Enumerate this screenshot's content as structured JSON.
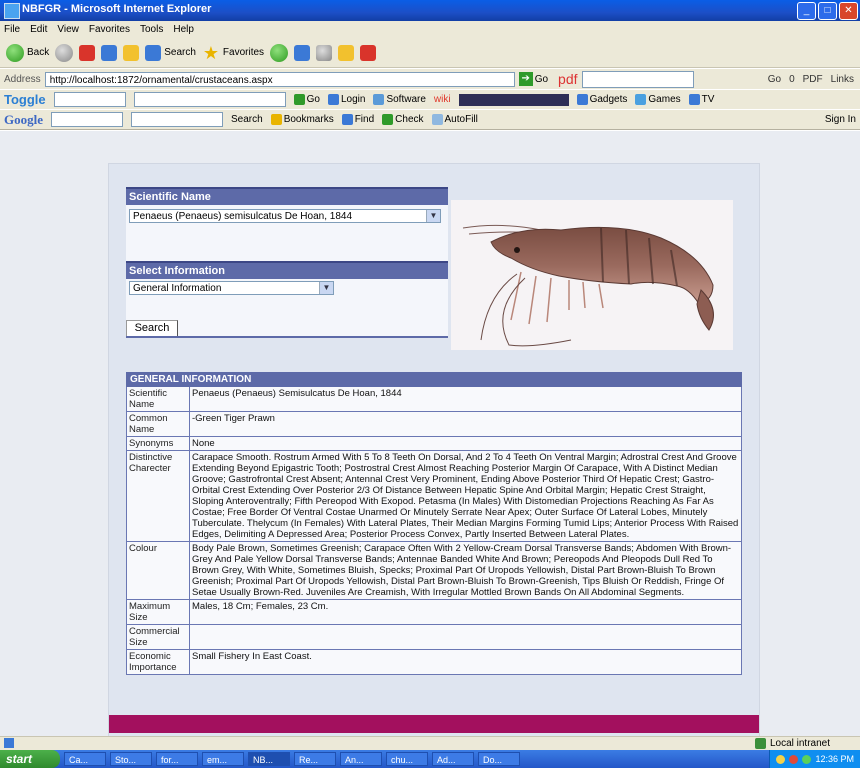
{
  "window": {
    "title": "NBFGR - Microsoft Internet Explorer"
  },
  "menu": [
    "File",
    "Edit",
    "View",
    "Favorites",
    "Tools",
    "Help"
  ],
  "toolbar": {
    "back": "Back",
    "search": "Search",
    "favorites": "Favorites"
  },
  "address": {
    "label": "Address",
    "url": "http://localhost:1872/ornamental/crustaceans.aspx",
    "go": "Go",
    "pdf": "pdf",
    "right_items": [
      "Go",
      "0",
      "PDF",
      "Links"
    ]
  },
  "toggle_bar": {
    "brand": "Toggle",
    "items": [
      "Go",
      "Login",
      "Software",
      "wiki",
      "Gadgets",
      "Games",
      "TV"
    ]
  },
  "google_bar": {
    "brand": "Google",
    "items": [
      "Search",
      "Bookmarks",
      "Find",
      "Check",
      "AutoFill",
      "Sign In"
    ]
  },
  "form": {
    "scientific_name_header": "Scientific Name",
    "scientific_name_value": "Penaeus (Penaeus) semisulcatus De Hoan, 1844",
    "select_info_header": "Select Information",
    "select_info_value": "General Information",
    "search_button": "Search"
  },
  "info": {
    "header": "GENERAL INFORMATION",
    "rows": [
      {
        "label": "Scientific Name",
        "value": "Penaeus (Penaeus) Semisulcatus De Hoan, 1844"
      },
      {
        "label": "Common Name",
        "value": "-Green Tiger Prawn"
      },
      {
        "label": "Synonyms",
        "value": "None"
      },
      {
        "label": "Distinctive Charecter",
        "value": "Carapace Smooth. Rostrum Armed With 5 To 8 Teeth On Dorsal, And 2 To 4 Teeth On Ventral Margin; Adrostral Crest And Groove Extending Beyond Epigastric Tooth; Postrostral Crest Almost Reaching Posterior Margin Of Carapace, With A Distinct Median Groove; Gastrofrontal Crest Absent; Antennal Crest Very Prominent, Ending Above Posterior Third Of Hepatic Crest; Gastro-Orbital Crest Extending Over Posterior 2/3 Of Distance Between Hepatic Spine And Orbital Margin; Hepatic Crest Straight, Sloping Anteroventrally; Fifth Pereopod With Exopod. Petasma (In Males) With Distomedian Projections Reaching As Far As Costae; Free Border Of Ventral Costae Unarmed Or Minutely Serrate Near Apex; Outer Surface Of Lateral Lobes, Minutely Tuberculate. Thelycum (In Females) With Lateral Plates, Their Median Margins Forming Tumid Lips; Anterior Process With Raised Edges, Delimiting A Depressed Area; Posterior Process Convex, Partly Inserted Between Lateral Plates."
      },
      {
        "label": "Colour",
        "value": "Body Pale Brown, Sometimes Greenish; Carapace Often With 2 Yellow-Cream Dorsal Transverse Bands; Abdomen With Brown-Grey And Pale Yellow Dorsal Transverse Bands; Antennae Banded White And Brown; Pereopods And Pleopods Dull Red To Brown Grey, With White, Sometimes Bluish, Specks; Proximal Part Of Uropods Yellowish, Distal Part Brown-Bluish To Brown Greenish; Proximal Part Of Uropods Yellowish, Distal Part Brown-Bluish To Brown-Greenish, Tips Bluish Or Reddish, Fringe Of Setae Usually Brown-Red. Juveniles Are Creamish, With Irregular Mottled Brown Bands On All Abdominal Segments."
      },
      {
        "label": "Maximum Size",
        "value": "Males, 18 Cm; Females, 23 Cm."
      },
      {
        "label": "Commercial Size",
        "value": ""
      },
      {
        "label": "Economic Importance",
        "value": "Small Fishery In East Coast."
      }
    ]
  },
  "status": {
    "zone": "Local intranet"
  },
  "taskbar": {
    "start": "start",
    "tasks": [
      "Ca...",
      "Sto...",
      "for...",
      "em...",
      "NB...",
      "Re...",
      "An...",
      "chu...",
      "Ad...",
      "Do..."
    ],
    "clock": "12:36 PM"
  }
}
